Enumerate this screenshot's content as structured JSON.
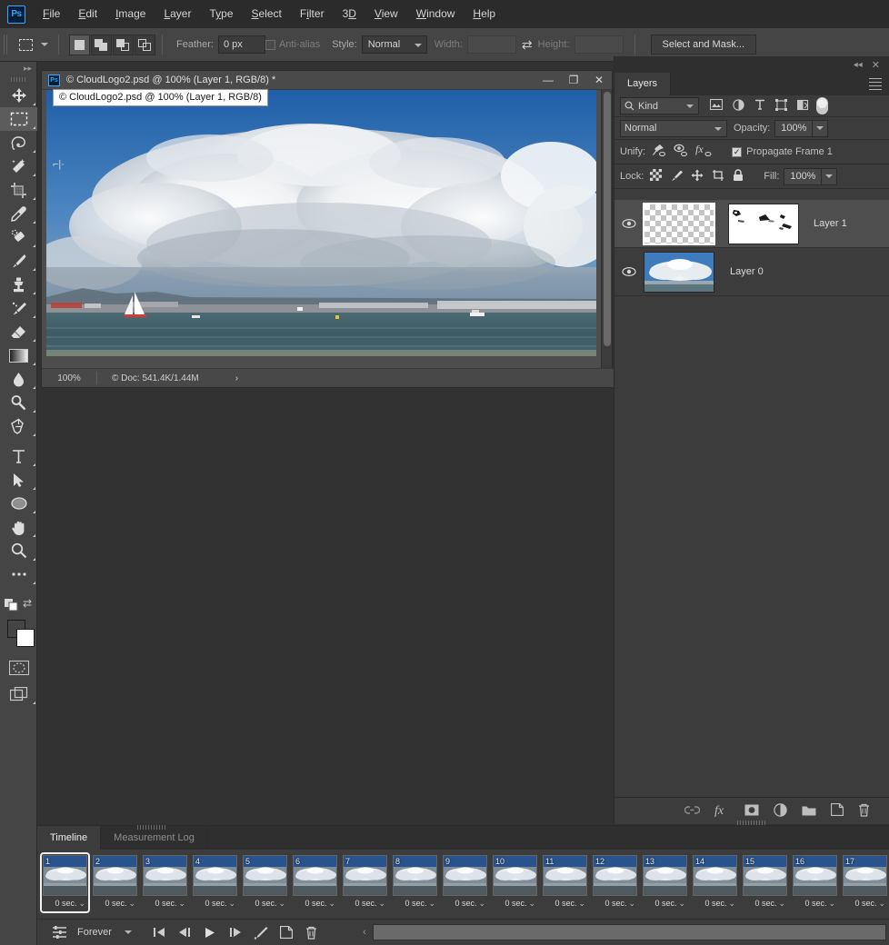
{
  "app": {
    "logo": "Ps",
    "accent": "#31a8ff"
  },
  "menubar": {
    "items": [
      "File",
      "Edit",
      "Image",
      "Layer",
      "Type",
      "Select",
      "Filter",
      "3D",
      "View",
      "Window",
      "Help"
    ]
  },
  "options_bar": {
    "tool_icon": "rectangular-marquee-icon",
    "selection_modes": [
      "new-selection",
      "add-to-selection",
      "subtract-from-selection",
      "intersect-selection"
    ],
    "feather_label": "Feather:",
    "feather_value": "0 px",
    "antialias_label": "Anti-alias",
    "antialias_checked": false,
    "style_label": "Style:",
    "style_value": "Normal",
    "width_label": "Width:",
    "width_value": "",
    "height_label": "Height:",
    "height_value": "",
    "swap_icon": "swap-width-height-icon",
    "select_and_mask": "Select and Mask..."
  },
  "toolbar": {
    "collapse_icon": "double-chevron-right-icon",
    "tools": [
      {
        "name": "move-tool",
        "selected": false
      },
      {
        "name": "rectangular-marquee-tool",
        "selected": true
      },
      {
        "name": "lasso-tool",
        "selected": false
      },
      {
        "name": "magic-wand-tool",
        "selected": false
      },
      {
        "name": "crop-tool",
        "selected": false
      },
      {
        "name": "eyedropper-tool",
        "selected": false
      },
      {
        "name": "healing-brush-tool",
        "selected": false
      },
      {
        "name": "brush-tool",
        "selected": false
      },
      {
        "name": "clone-stamp-tool",
        "selected": false
      },
      {
        "name": "history-brush-tool",
        "selected": false
      },
      {
        "name": "eraser-tool",
        "selected": false
      },
      {
        "name": "gradient-tool",
        "selected": false
      },
      {
        "name": "blur-tool",
        "selected": false
      },
      {
        "name": "dodge-tool",
        "selected": false
      },
      {
        "name": "pen-tool",
        "selected": false
      },
      {
        "name": "type-tool",
        "selected": false
      },
      {
        "name": "path-selection-tool",
        "selected": false
      },
      {
        "name": "ellipse-shape-tool",
        "selected": false
      },
      {
        "name": "hand-tool",
        "selected": false
      },
      {
        "name": "zoom-tool",
        "selected": false
      },
      {
        "name": "edit-toolbar-tool",
        "selected": false
      }
    ],
    "foreground_color": "#ff0000",
    "background_color": "#ffffff",
    "quick_mask_icon": "quick-mask-icon",
    "screen_mode_icon": "screen-mode-icon"
  },
  "document": {
    "title": "© CloudLogo2.psd @ 100% (Layer 1, RGB/8) *",
    "tooltip": "© CloudLogo2.psd @ 100% (Layer 1, RGB/8)",
    "minimize_icon": "minimize-icon",
    "maximize_icon": "maximize-icon",
    "close_icon": "close-icon",
    "zoom": "100%",
    "doc_info": "© Doc: 541.4K/1.44M",
    "status_arrow": "›"
  },
  "layers_panel": {
    "collapse_icon": "collapse-panel-icon",
    "close_icon": "close-panel-icon",
    "menu_icon": "panel-menu-icon",
    "tab_label": "Layers",
    "filter": {
      "kind_label": "Kind",
      "search_icon": "search-icon",
      "icons": [
        "pixel-filter-icon",
        "adjustment-filter-icon",
        "type-filter-icon",
        "shape-filter-icon",
        "smart-object-filter-icon"
      ],
      "toggle_icon": "filter-enable-toggle"
    },
    "blend_mode": "Normal",
    "opacity_label": "Opacity:",
    "opacity_value": "100%",
    "unify_label": "Unify:",
    "unify_icons": [
      "unify-position-icon",
      "unify-visibility-icon",
      "unify-style-icon"
    ],
    "propagate_label": "Propagate Frame 1",
    "propagate_checked": true,
    "lock_label": "Lock:",
    "lock_icons": [
      "lock-transparency-icon",
      "lock-image-icon",
      "lock-position-icon",
      "lock-artboard-icon",
      "lock-all-icon"
    ],
    "fill_label": "Fill:",
    "fill_value": "100%",
    "layers": [
      {
        "name": "Layer 1",
        "visible": true,
        "selected": true,
        "thumb_type": "transparent",
        "has_mask": true
      },
      {
        "name": "Layer 0",
        "visible": true,
        "selected": false,
        "thumb_type": "image",
        "has_mask": false
      }
    ],
    "bottom_icons": [
      "link-layers-icon",
      "layer-style-fx-icon",
      "add-layer-mask-icon",
      "new-adjustment-layer-icon",
      "new-group-icon",
      "new-layer-icon",
      "delete-layer-icon"
    ]
  },
  "timeline_panel": {
    "tabs": [
      {
        "label": "Timeline",
        "active": true
      },
      {
        "label": "Measurement Log",
        "active": false
      }
    ],
    "frames": [
      {
        "number": "1",
        "delay": "0 sec.",
        "selected": true
      },
      {
        "number": "2",
        "delay": "0 sec.",
        "selected": false
      },
      {
        "number": "3",
        "delay": "0 sec.",
        "selected": false
      },
      {
        "number": "4",
        "delay": "0 sec.",
        "selected": false
      },
      {
        "number": "5",
        "delay": "0 sec.",
        "selected": false
      },
      {
        "number": "6",
        "delay": "0 sec.",
        "selected": false
      },
      {
        "number": "7",
        "delay": "0 sec.",
        "selected": false
      },
      {
        "number": "8",
        "delay": "0 sec.",
        "selected": false
      },
      {
        "number": "9",
        "delay": "0 sec.",
        "selected": false
      },
      {
        "number": "10",
        "delay": "0 sec.",
        "selected": false
      },
      {
        "number": "11",
        "delay": "0 sec.",
        "selected": false
      },
      {
        "number": "12",
        "delay": "0 sec.",
        "selected": false
      },
      {
        "number": "13",
        "delay": "0 sec.",
        "selected": false
      },
      {
        "number": "14",
        "delay": "0 sec.",
        "selected": false
      },
      {
        "number": "15",
        "delay": "0 sec.",
        "selected": false
      },
      {
        "number": "16",
        "delay": "0 sec.",
        "selected": false
      },
      {
        "number": "17",
        "delay": "0 sec.",
        "selected": false
      }
    ],
    "controls": {
      "convert_icon": "convert-to-video-timeline-icon",
      "loop_value": "Forever",
      "first_frame_icon": "select-first-frame-icon",
      "previous_frame_icon": "select-previous-frame-icon",
      "play_icon": "play-animation-icon",
      "next_frame_icon": "select-next-frame-icon",
      "tween_icon": "tween-frames-icon",
      "duplicate_icon": "duplicate-frame-icon",
      "delete_icon": "delete-frame-icon",
      "scroll_arrow_icon": "scroll-left-icon"
    }
  }
}
